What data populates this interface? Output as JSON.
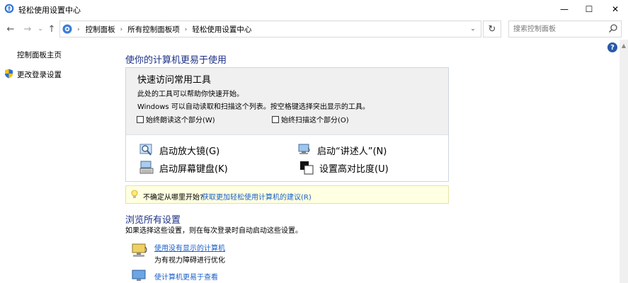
{
  "window": {
    "title": "轻松使用设置中心",
    "minimize_glyph": "—",
    "maximize_glyph": "☐",
    "close_glyph": "✕"
  },
  "nav": {
    "back_glyph": "←",
    "forward_glyph": "→",
    "up_glyph": "↑",
    "breadcrumb": [
      "控制面板",
      "所有控制面板项",
      "轻松使用设置中心"
    ],
    "refresh_glyph": "↻",
    "search_placeholder": "搜索控制面板",
    "search_glyph": "⌕"
  },
  "sidebar": {
    "home_link": "控制面板主页",
    "logon_link": "更改登录设置"
  },
  "help_glyph": "?",
  "main": {
    "title": "使你的计算机更易于使用",
    "quick": {
      "title": "快速访问常用工具",
      "line1": "此处的工具可以帮助你快速开始。",
      "line2": "Windows 可以自动读取和扫描这个列表。按空格键选择突出显示的工具。",
      "check_read": "始终朗读这个部分(W)",
      "check_scan": "始终扫描这个部分(O)",
      "tools": [
        "启动放大镜(G)",
        "启动“讲述人”(N)",
        "启动屏幕键盘(K)",
        "设置高对比度(U)"
      ]
    },
    "tip": {
      "text": "不确定从哪里开始?",
      "link": "获取更加轻松使用计算机的建议(R)"
    },
    "browse": {
      "title": "浏览所有设置",
      "desc": "如果选择这些设置，则在每次登录时自动启动这些设置。",
      "opt1_link": "使用没有显示的计算机",
      "opt1_sub": "为有视力障碍进行优化",
      "opt2_link": "使计算机更易于查看"
    }
  },
  "icons": {
    "app": "ease-of-access-icon",
    "address": "control-panel-icon",
    "shield": "uac-shield-icon",
    "magnifier": "magnifier-icon",
    "narrator": "narrator-icon",
    "keyboard": "on-screen-keyboard-icon",
    "contrast": "high-contrast-icon",
    "bulb": "lightbulb-icon"
  },
  "colors": {
    "heading_blue": "#1e3287",
    "link_blue": "#1a5fc8",
    "tip_bg": "#ffffe1"
  }
}
